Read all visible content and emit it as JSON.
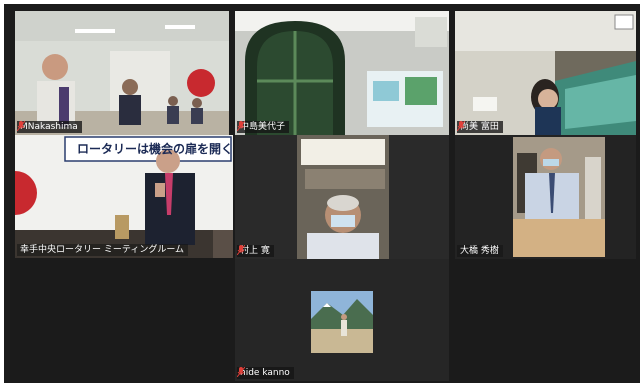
{
  "participants": [
    {
      "name": "MNakashima",
      "muted": true
    },
    {
      "name": "中島美代子",
      "muted": true
    },
    {
      "name": "尚美 富田",
      "muted": true
    },
    {
      "name": "幸手中央ロータリー ミーティングルーム",
      "muted": false
    },
    {
      "name": "村上 寛",
      "muted": true
    },
    {
      "name": "大橋 秀樹",
      "muted": false
    },
    {
      "name": "hide kanno",
      "muted": true
    }
  ],
  "banner_text": "ロータリーは機会の扉を開く",
  "colors": {
    "active_speaker": "#c5dc4a",
    "muted_icon": "#e0403a",
    "background": "#1b1b1b"
  },
  "icons": {
    "muted": "mic-muted-icon"
  }
}
